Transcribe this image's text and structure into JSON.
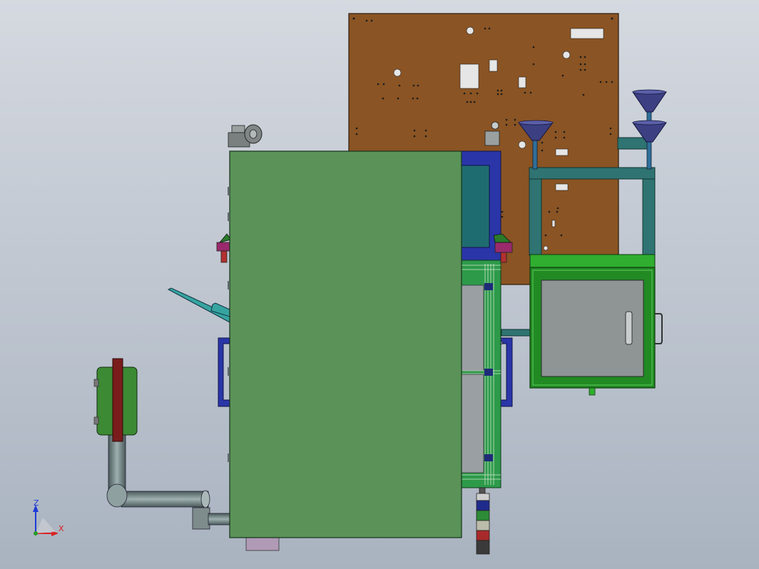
{
  "viewport": {
    "background_top": "#d5d9e0",
    "background_bottom": "#a9b3c0"
  },
  "triad": {
    "z_label": "Z",
    "x_label": "X",
    "z_color": "#1f3bd6",
    "x_color": "#d92020",
    "y_color": "#2a9a2a"
  },
  "colors": {
    "circuit_board": "#8a5424",
    "front_panel": "#5a9258",
    "cabinet_frame": "#218a23",
    "cabinet_door": "#8f9494",
    "teal_frame": "#2f7472",
    "hopper": "#3c3f82",
    "blue_frame": "#2a35a8",
    "pipe": "#76898a",
    "motor_housing": "#3c8a34",
    "red_shaft": "#7a1c1c"
  },
  "stack_light": {
    "segments": [
      "#1f2b8c",
      "#2d8a36",
      "#bcbcaa",
      "#a82a2a",
      "#3a3a3a"
    ]
  }
}
